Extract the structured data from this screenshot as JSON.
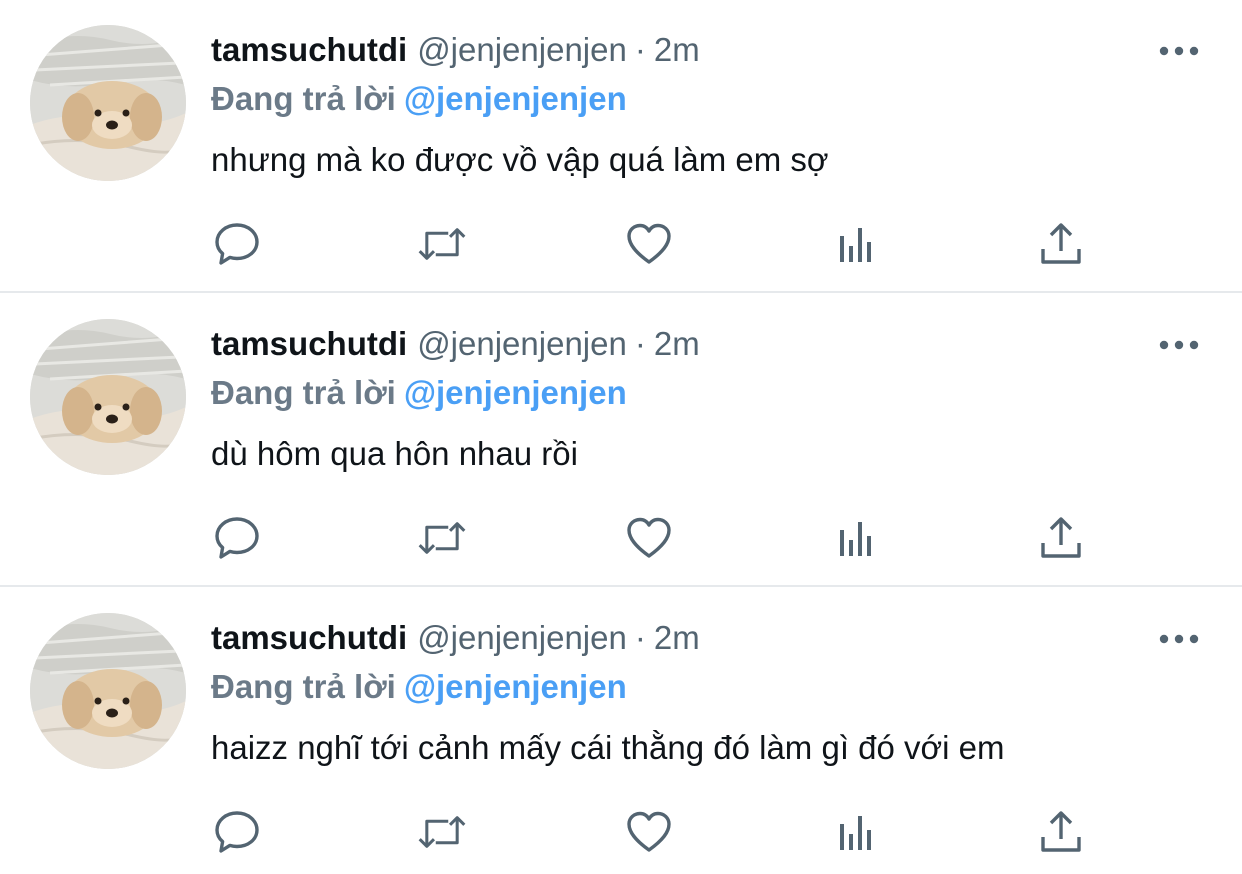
{
  "colors": {
    "name": "#0f1419",
    "secondary": "#536471",
    "reply_prefix": "#6b7a88",
    "mention": "#4a9ff5",
    "icon": "#536471",
    "divider": "#e6e9ec"
  },
  "icons": {
    "reply": "speech-bubble-icon",
    "retweet": "retweet-icon",
    "like": "heart-icon",
    "stats": "bar-chart-icon",
    "share": "share-upload-icon",
    "more": "three-dots-icon"
  },
  "tweets": [
    {
      "display_name": "tamsuchutdi",
      "handle": "@jenjenjenjen",
      "separator": "·",
      "time": "2m",
      "reply_prefix": "Đang trả lời",
      "reply_to": "@jenjenjenjen",
      "text": "nhưng mà ko được vồ vập quá làm em sợ"
    },
    {
      "display_name": "tamsuchutdi",
      "handle": "@jenjenjenjen",
      "separator": "·",
      "time": "2m",
      "reply_prefix": "Đang trả lời",
      "reply_to": "@jenjenjenjen",
      "text": "dù hôm qua hôn nhau rồi"
    },
    {
      "display_name": "tamsuchutdi",
      "handle": "@jenjenjenjen",
      "separator": "·",
      "time": "2m",
      "reply_prefix": "Đang trả lời",
      "reply_to": "@jenjenjenjen",
      "text": "haizz nghĩ tới cảnh mấy cái thằng đó làm gì đó với em"
    }
  ]
}
